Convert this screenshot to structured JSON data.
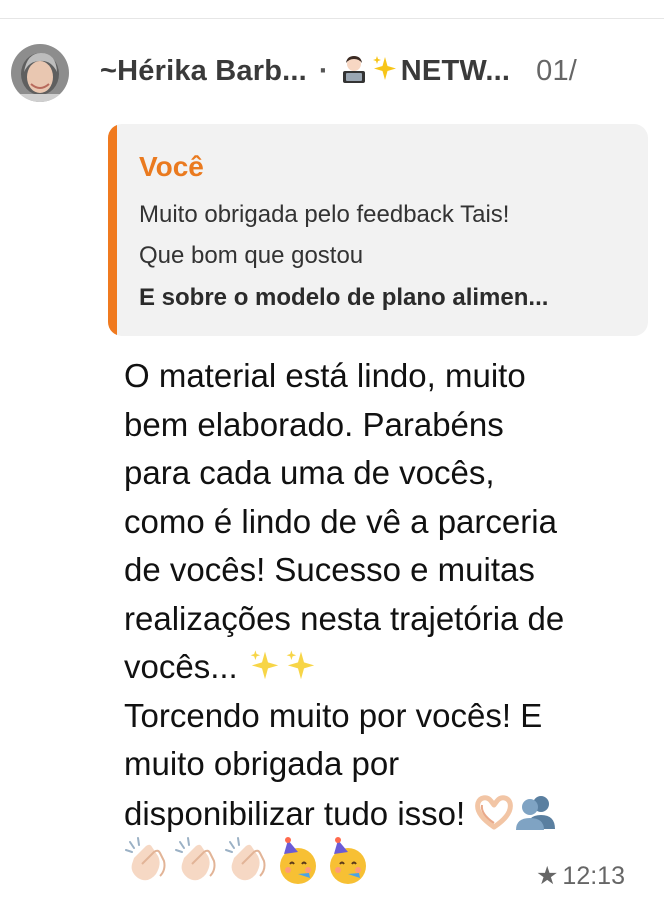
{
  "chat": {
    "sender_name": "~Hérika Barb...",
    "separator": "·",
    "group_name": "NETW...",
    "date_fragment": "01/",
    "quoted": {
      "author": "Você",
      "line1": "Muito obrigada pelo feedback Tais!",
      "line2": "Que bom que gostou",
      "line3": "E sobre o modelo de plano alimen..."
    },
    "message_lines": [
      "O material está lindo, muito",
      "bem elaborado. Parabéns",
      "para cada uma de vocês,",
      "como é lindo de vê a parceria",
      "de vocês! Sucesso e muitas",
      "realizações nesta trajetória de",
      "vocês...",
      "Torcendo muito por vocês! E",
      "muito obrigada por",
      "disponibilizar tudo isso!"
    ],
    "star_icon": "★",
    "time": "12:13",
    "emoji_names": [
      "technologist-emoji",
      "sparkles-emoji",
      "heart-hands-emoji",
      "busts-in-silhouette-emoji",
      "clapping-hands-emoji",
      "partying-face-emoji"
    ]
  },
  "colors": {
    "accent_orange": "#f07a1f",
    "quote_background": "#f2f2f2",
    "text_primary": "#111111",
    "text_secondary": "#666666"
  }
}
